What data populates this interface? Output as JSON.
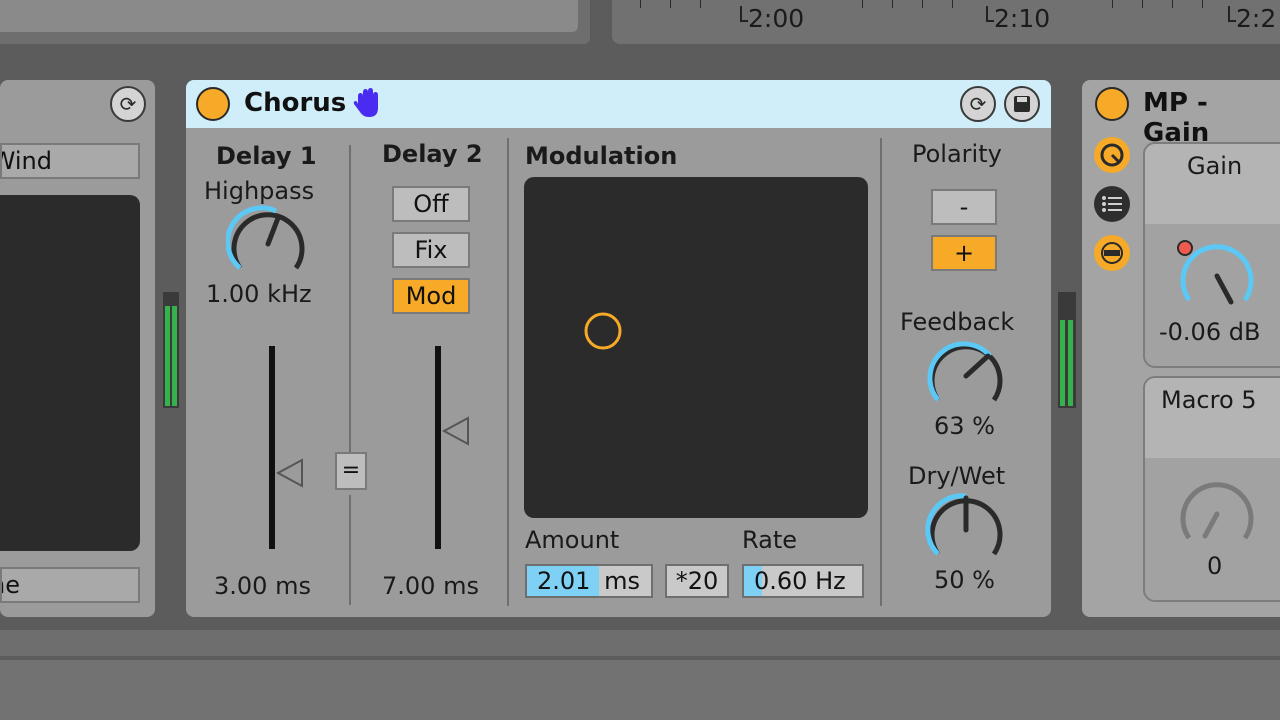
{
  "timeline": {
    "markers": [
      "2:00",
      "2:10",
      "2:2"
    ]
  },
  "left_device": {
    "field_top": "Wind",
    "field_bottom": "ne"
  },
  "chorus": {
    "title": "Chorus",
    "delay1": {
      "heading": "Delay 1",
      "highpass_label": "Highpass",
      "highpass_value": "1.00 kHz",
      "time_value": "3.00 ms"
    },
    "link_button": "=",
    "delay2": {
      "heading": "Delay 2",
      "modes": [
        "Off",
        "Fix",
        "Mod"
      ],
      "selected_mode": "Mod",
      "time_value": "7.00 ms"
    },
    "modulation": {
      "heading": "Modulation",
      "amount_label": "Amount",
      "amount_value": "2.01",
      "amount_unit": "ms",
      "multiplier": "*20",
      "rate_label": "Rate",
      "rate_value": "0.60 Hz"
    },
    "polarity": {
      "heading": "Polarity",
      "options": [
        "-",
        "+"
      ],
      "selected": "+"
    },
    "feedback": {
      "label": "Feedback",
      "value": "63 %"
    },
    "drywet": {
      "label": "Dry/Wet",
      "value": "50 %"
    }
  },
  "rack": {
    "title": "MP - Gain",
    "macros": [
      {
        "name": "Gain",
        "value": "-0.06 dB"
      },
      {
        "name": "Macro 5",
        "value": "0"
      }
    ]
  },
  "colors": {
    "accent": "#f7a928",
    "header": "#cfeefa",
    "knob_arc": "#5bc8f5",
    "panel": "#9b9b9b"
  }
}
